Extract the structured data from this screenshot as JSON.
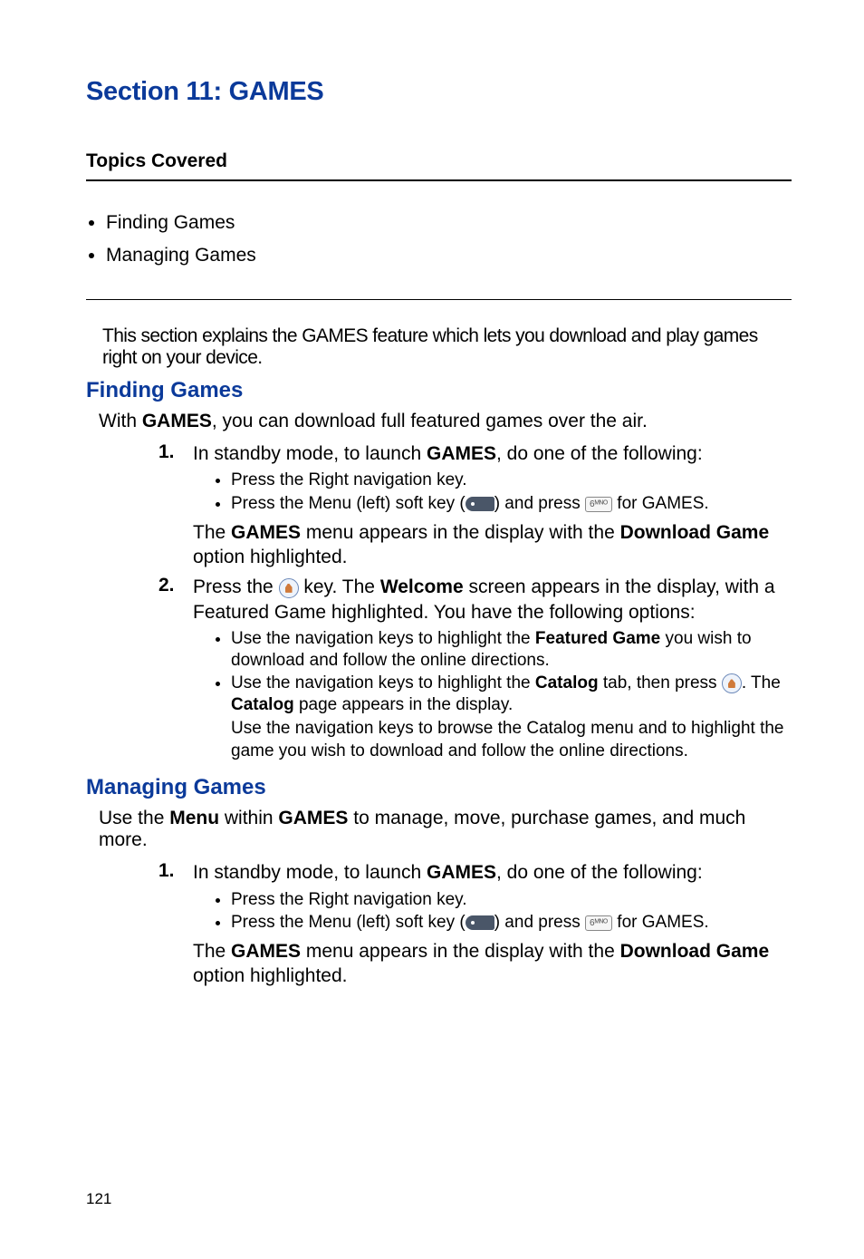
{
  "section_title": "Section 11: GAMES",
  "topics": {
    "heading": "Topics Covered",
    "items": [
      "Finding Games",
      "Managing Games"
    ]
  },
  "intro": "This section explains the GAMES feature which lets you download and play games right on your device.",
  "finding": {
    "heading": "Finding Games",
    "lead_pre": "With ",
    "lead_bold": "GAMES",
    "lead_post": ", you can download full featured games over the air.",
    "step1": {
      "pre": "In standby mode, to launch ",
      "bold": "GAMES",
      "post": ", do one of the following:",
      "bul1": "Press the Right navigation key.",
      "bul2_pre": "Press the Menu (left) soft key (",
      "bul2_mid": ") and press ",
      "bul2_post": " for GAMES.",
      "result_pre": "The ",
      "result_b1": "GAMES",
      "result_mid": " menu appears in the display with the ",
      "result_b2": "Download Game",
      "result_post": " option highlighted."
    },
    "step2": {
      "pre": "Press the ",
      "mid": " key. The ",
      "b1": "Welcome",
      "post": " screen appears in the display, with a Featured Game highlighted. You have the following options:",
      "bul1_pre": "Use the navigation keys to highlight the ",
      "bul1_b": "Featured Game",
      "bul1_post": " you wish to download and follow the online directions.",
      "bul2_pre": "Use the navigation keys to highlight the ",
      "bul2_b1": "Catalog",
      "bul2_mid1": " tab, then press ",
      "bul2_mid2": ". The ",
      "bul2_b2": "Catalog",
      "bul2_post": " page appears in the display.",
      "bul2_cont": "Use the navigation keys to browse the Catalog menu and to highlight the game you wish to download and follow the online directions."
    }
  },
  "managing": {
    "heading": "Managing Games",
    "lead_pre": "Use the ",
    "lead_b1": "Menu",
    "lead_mid": " within ",
    "lead_b2": "GAMES",
    "lead_post": " to manage, move, purchase games, and much more.",
    "step1": {
      "pre": "In standby mode, to launch ",
      "bold": "GAMES",
      "post": ", do one of the following:",
      "bul1": "Press the Right navigation key.",
      "bul2_pre": "Press the Menu (left) soft key (",
      "bul2_mid": ") and press ",
      "bul2_post": " for GAMES.",
      "result_pre": "The ",
      "result_b1": "GAMES",
      "result_mid": " menu appears in the display with the ",
      "result_b2": "Download Game",
      "result_post": " option highlighted."
    }
  },
  "six_label": "6ᴹᴺᴼ",
  "page_number": "121"
}
